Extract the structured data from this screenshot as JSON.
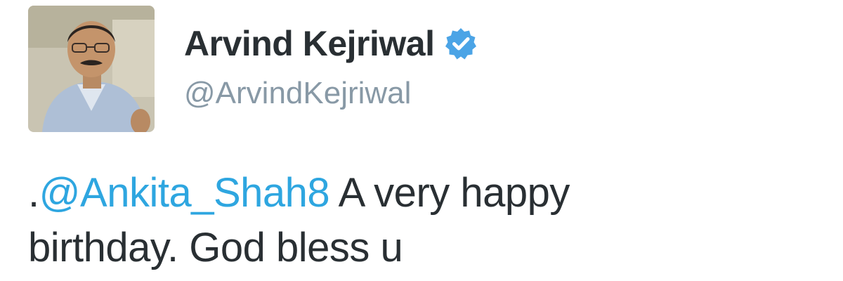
{
  "author": {
    "display_name": "Arvind Kejriwal",
    "handle": "@ArvindKejriwal",
    "verified": true,
    "avatar_icon": "profile-photo"
  },
  "tweet": {
    "prefix": ".",
    "mention": "@Ankita_Shah8",
    "line1_rest": " A very happy",
    "line2": "birthday. God bless u"
  },
  "colors": {
    "name": "#292f33",
    "handle": "#8899a6",
    "mention": "#2ea6e0",
    "verified_badge": "#4ba4e6"
  }
}
